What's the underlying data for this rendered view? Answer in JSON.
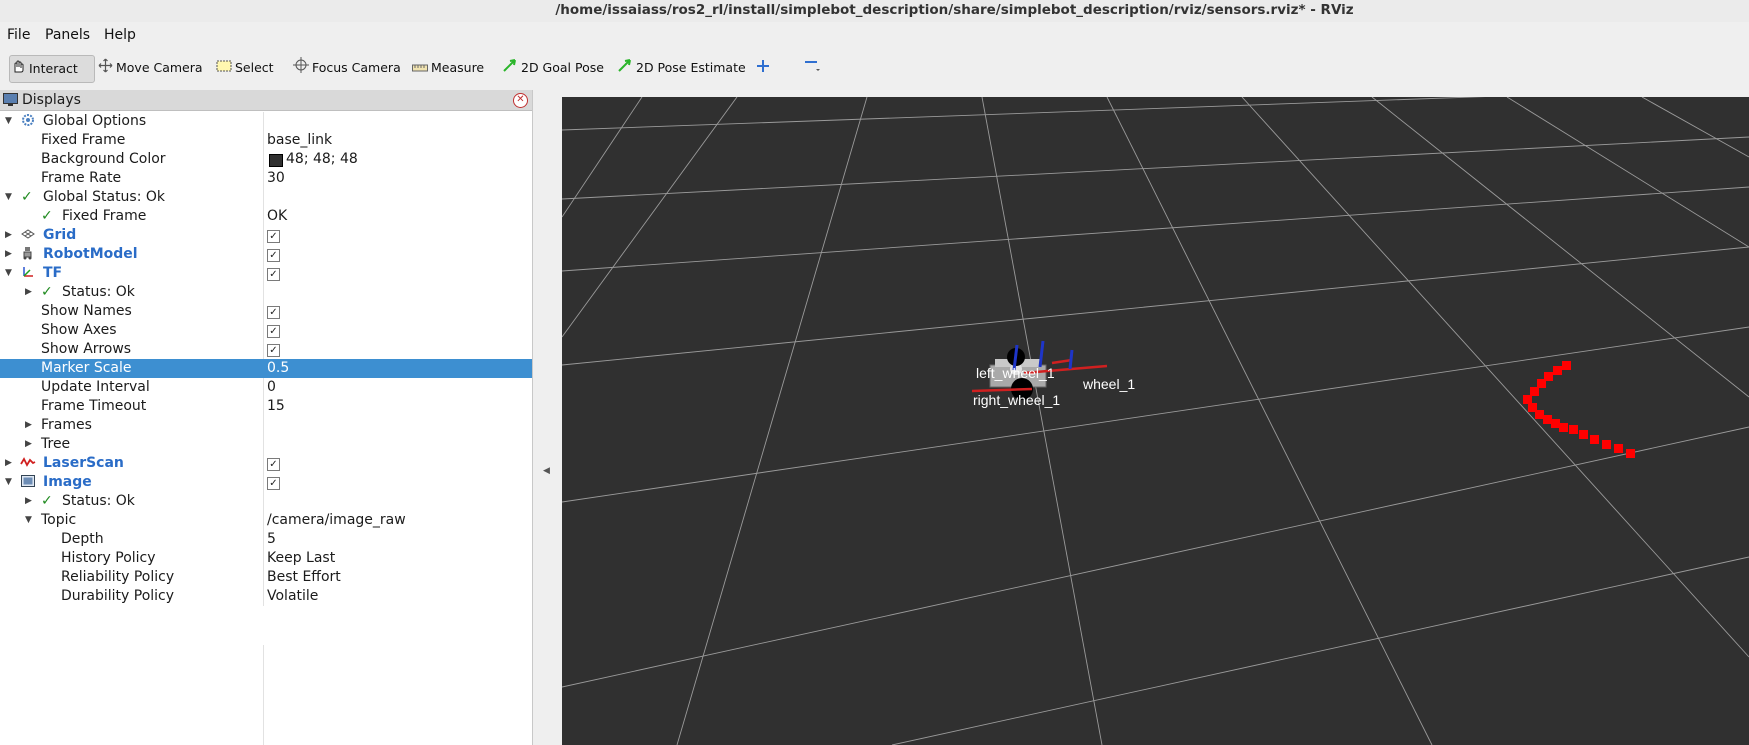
{
  "window": {
    "title": "/home/issaiass/ros2_rl/install/simplebot_description/share/simplebot_description/rviz/sensors.rviz* - RViz"
  },
  "menu": {
    "items": [
      "File",
      "Panels",
      "Help"
    ]
  },
  "toolbar": {
    "tools": [
      "Interact",
      "Move Camera",
      "Select",
      "Focus Camera",
      "Measure",
      "2D Goal Pose",
      "2D Pose Estimate"
    ],
    "add_tool_icon": "plus-icon",
    "remove_tool_icon": "minus-icon"
  },
  "displays": {
    "title": "Displays",
    "rows": [
      {
        "label": "Global Options",
        "value": ""
      },
      {
        "label": "Fixed Frame",
        "value": "base_link"
      },
      {
        "label": "Background Color",
        "value": "48; 48; 48"
      },
      {
        "label": "Frame Rate",
        "value": "30"
      },
      {
        "label": "Global Status: Ok",
        "value": ""
      },
      {
        "label": "Fixed Frame",
        "value": "OK"
      },
      {
        "label": "Grid",
        "value": ""
      },
      {
        "label": "RobotModel",
        "value": ""
      },
      {
        "label": "TF",
        "value": ""
      },
      {
        "label": "Status: Ok",
        "value": ""
      },
      {
        "label": "Show Names",
        "value": ""
      },
      {
        "label": "Show Axes",
        "value": ""
      },
      {
        "label": "Show Arrows",
        "value": ""
      },
      {
        "label": "Marker Scale",
        "value": "0.5"
      },
      {
        "label": "Update Interval",
        "value": "0"
      },
      {
        "label": "Frame Timeout",
        "value": "15"
      },
      {
        "label": "Frames",
        "value": ""
      },
      {
        "label": "Tree",
        "value": ""
      },
      {
        "label": "LaserScan",
        "value": ""
      },
      {
        "label": "Image",
        "value": ""
      },
      {
        "label": "Status: Ok",
        "value": ""
      },
      {
        "label": "Topic",
        "value": "/camera/image_raw"
      },
      {
        "label": "Depth",
        "value": "5"
      },
      {
        "label": "History Policy",
        "value": "Keep Last"
      },
      {
        "label": "Reliability Policy",
        "value": "Best Effort"
      },
      {
        "label": "Durability Policy",
        "value": "Volatile"
      }
    ],
    "checked": {
      "grid": true,
      "robotmodel": true,
      "tf": true,
      "show_names": true,
      "show_axes": true,
      "show_arrows": true,
      "laserscan": true,
      "image": true
    }
  },
  "scene": {
    "background": "#303030",
    "grid_color": "#a0a0a0",
    "laser_color": "#ff0000",
    "frame_labels": [
      "left_wheel_1",
      "wheel_1",
      "right_wheel_1"
    ]
  },
  "colors": {
    "selection": "#3d8fd1",
    "display_name": "#2a6cc7",
    "ok_check": "#1f8a1f",
    "background_swatch": "#303030"
  }
}
